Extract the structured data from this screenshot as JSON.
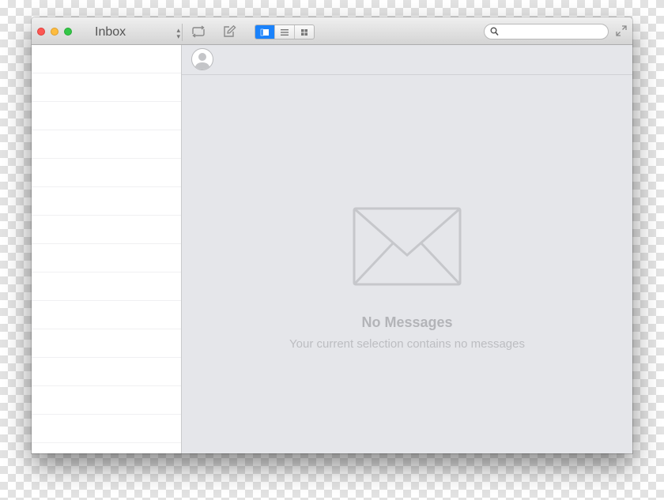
{
  "titlebar": {
    "mailbox": "Inbox",
    "search": {
      "placeholder": "",
      "value": ""
    }
  },
  "toolbar": {
    "buttons": [
      "refresh-icon",
      "compose-icon"
    ],
    "view_modes": [
      "preview-view-icon",
      "list-view-icon",
      "grid-view-icon"
    ],
    "active_view": 0
  },
  "content": {
    "empty_title": "No Messages",
    "empty_subtitle": "Your current selection contains no messages"
  },
  "colors": {
    "accent": "#1a82fb",
    "close": "#fc5753",
    "minimize": "#fdbc40",
    "maximize": "#33c748"
  }
}
